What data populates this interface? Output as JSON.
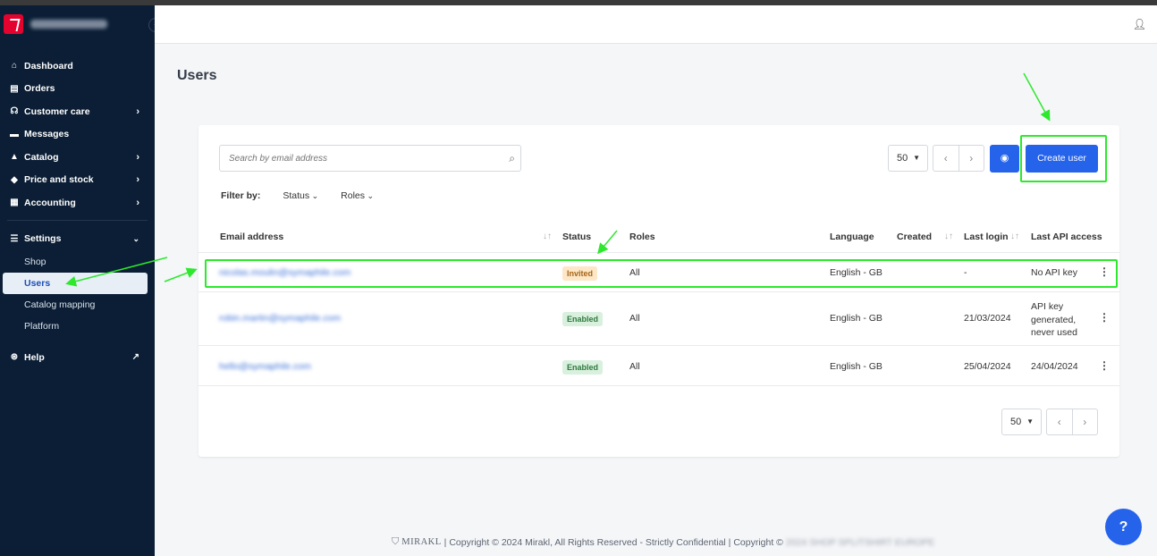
{
  "sidebar": {
    "brand_name": "SHOP SPLITSHIRT",
    "items": [
      {
        "label": "Dashboard",
        "icon": "home-icon"
      },
      {
        "label": "Orders",
        "icon": "clipboard-icon"
      },
      {
        "label": "Customer care",
        "icon": "headset-icon"
      },
      {
        "label": "Messages",
        "icon": "message-icon"
      },
      {
        "label": "Catalog",
        "icon": "catalog-icon"
      },
      {
        "label": "Price and stock",
        "icon": "tag-icon"
      },
      {
        "label": "Accounting",
        "icon": "document-icon"
      }
    ],
    "settings": {
      "label": "Settings",
      "icon": "sliders-icon"
    },
    "settings_sub": [
      "Shop",
      "Users",
      "Catalog mapping",
      "Platform"
    ],
    "help": {
      "label": "Help",
      "icon": "life-ring-icon"
    }
  },
  "page": {
    "title": "Users"
  },
  "toolbar": {
    "search_placeholder": "Search by email address",
    "per_page": "50",
    "create_label": "Create user"
  },
  "filters": {
    "label": "Filter by:",
    "status": "Status",
    "roles": "Roles"
  },
  "table": {
    "headers": {
      "email": "Email address",
      "status": "Status",
      "roles": "Roles",
      "language": "Language",
      "created": "Created",
      "last_login": "Last login",
      "last_api": "Last API access"
    },
    "rows": [
      {
        "email": "nicolas.moulin@symaphile.com",
        "status": "Invited",
        "roles": "All",
        "language": "English - GB",
        "created": "",
        "last_login": "-",
        "last_api": "No API key"
      },
      {
        "email": "robin.martin@symaphile.com",
        "status": "Enabled",
        "roles": "All",
        "language": "English - GB",
        "created": "",
        "last_login": "21/03/2024",
        "last_api": "API key generated, never used"
      },
      {
        "email": "hello@symaphile.com",
        "status": "Enabled",
        "roles": "All",
        "language": "English - GB",
        "created": "",
        "last_login": "25/04/2024",
        "last_api": "24/04/2024"
      }
    ]
  },
  "bottom_pager": {
    "per_page": "50"
  },
  "footer": {
    "brand": "MIRAKL",
    "text": "| Copyright © 2024 Mirakl, All Rights Reserved - Strictly Confidential | Copyright ©",
    "owner": "2024 SHOP SPLITSHIRT EUROPE"
  },
  "colors": {
    "accent": "#2563eb",
    "sidebar": "#0b1e35",
    "annotation": "#2de82d"
  }
}
